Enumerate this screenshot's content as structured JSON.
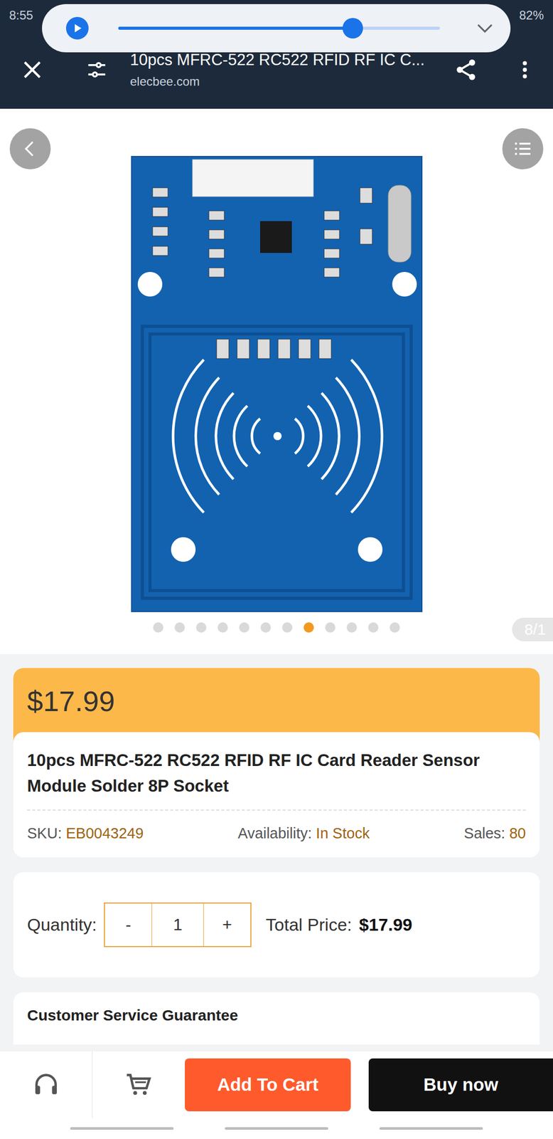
{
  "status_bar": {
    "time": "8:55",
    "battery": "82%"
  },
  "media": {
    "level": 0.73
  },
  "toolbar": {
    "title": "10pcs MFRC-522 RC522 RFID RF IC C...",
    "url": "elecbee.com"
  },
  "gallery": {
    "dots": [
      {
        "selected": false
      },
      {
        "selected": false
      },
      {
        "selected": false
      },
      {
        "selected": false
      },
      {
        "selected": false
      },
      {
        "selected": false
      },
      {
        "selected": false
      },
      {
        "selected": true
      },
      {
        "selected": false
      },
      {
        "selected": false
      },
      {
        "selected": false
      },
      {
        "selected": false
      }
    ],
    "counter": "8/1"
  },
  "price": "$17.99",
  "product": {
    "title": "10pcs MFRC-522 RC522 RFID RF IC Card Reader Sensor Module Solder 8P Socket",
    "sku_label": "SKU:",
    "sku": "EB0043249",
    "availability_label": "Availability:",
    "availability": "In Stock",
    "sales_label": "Sales:",
    "sales": "80"
  },
  "quantity": {
    "label": "Quantity:",
    "minus": "-",
    "value": "1",
    "plus": "+",
    "total_label": "Total Price:",
    "total": "$17.99"
  },
  "guarantee": {
    "title": "Customer Service Guarantee"
  },
  "actions": {
    "add_to_cart": "Add To Cart",
    "buy_now": "Buy now"
  }
}
